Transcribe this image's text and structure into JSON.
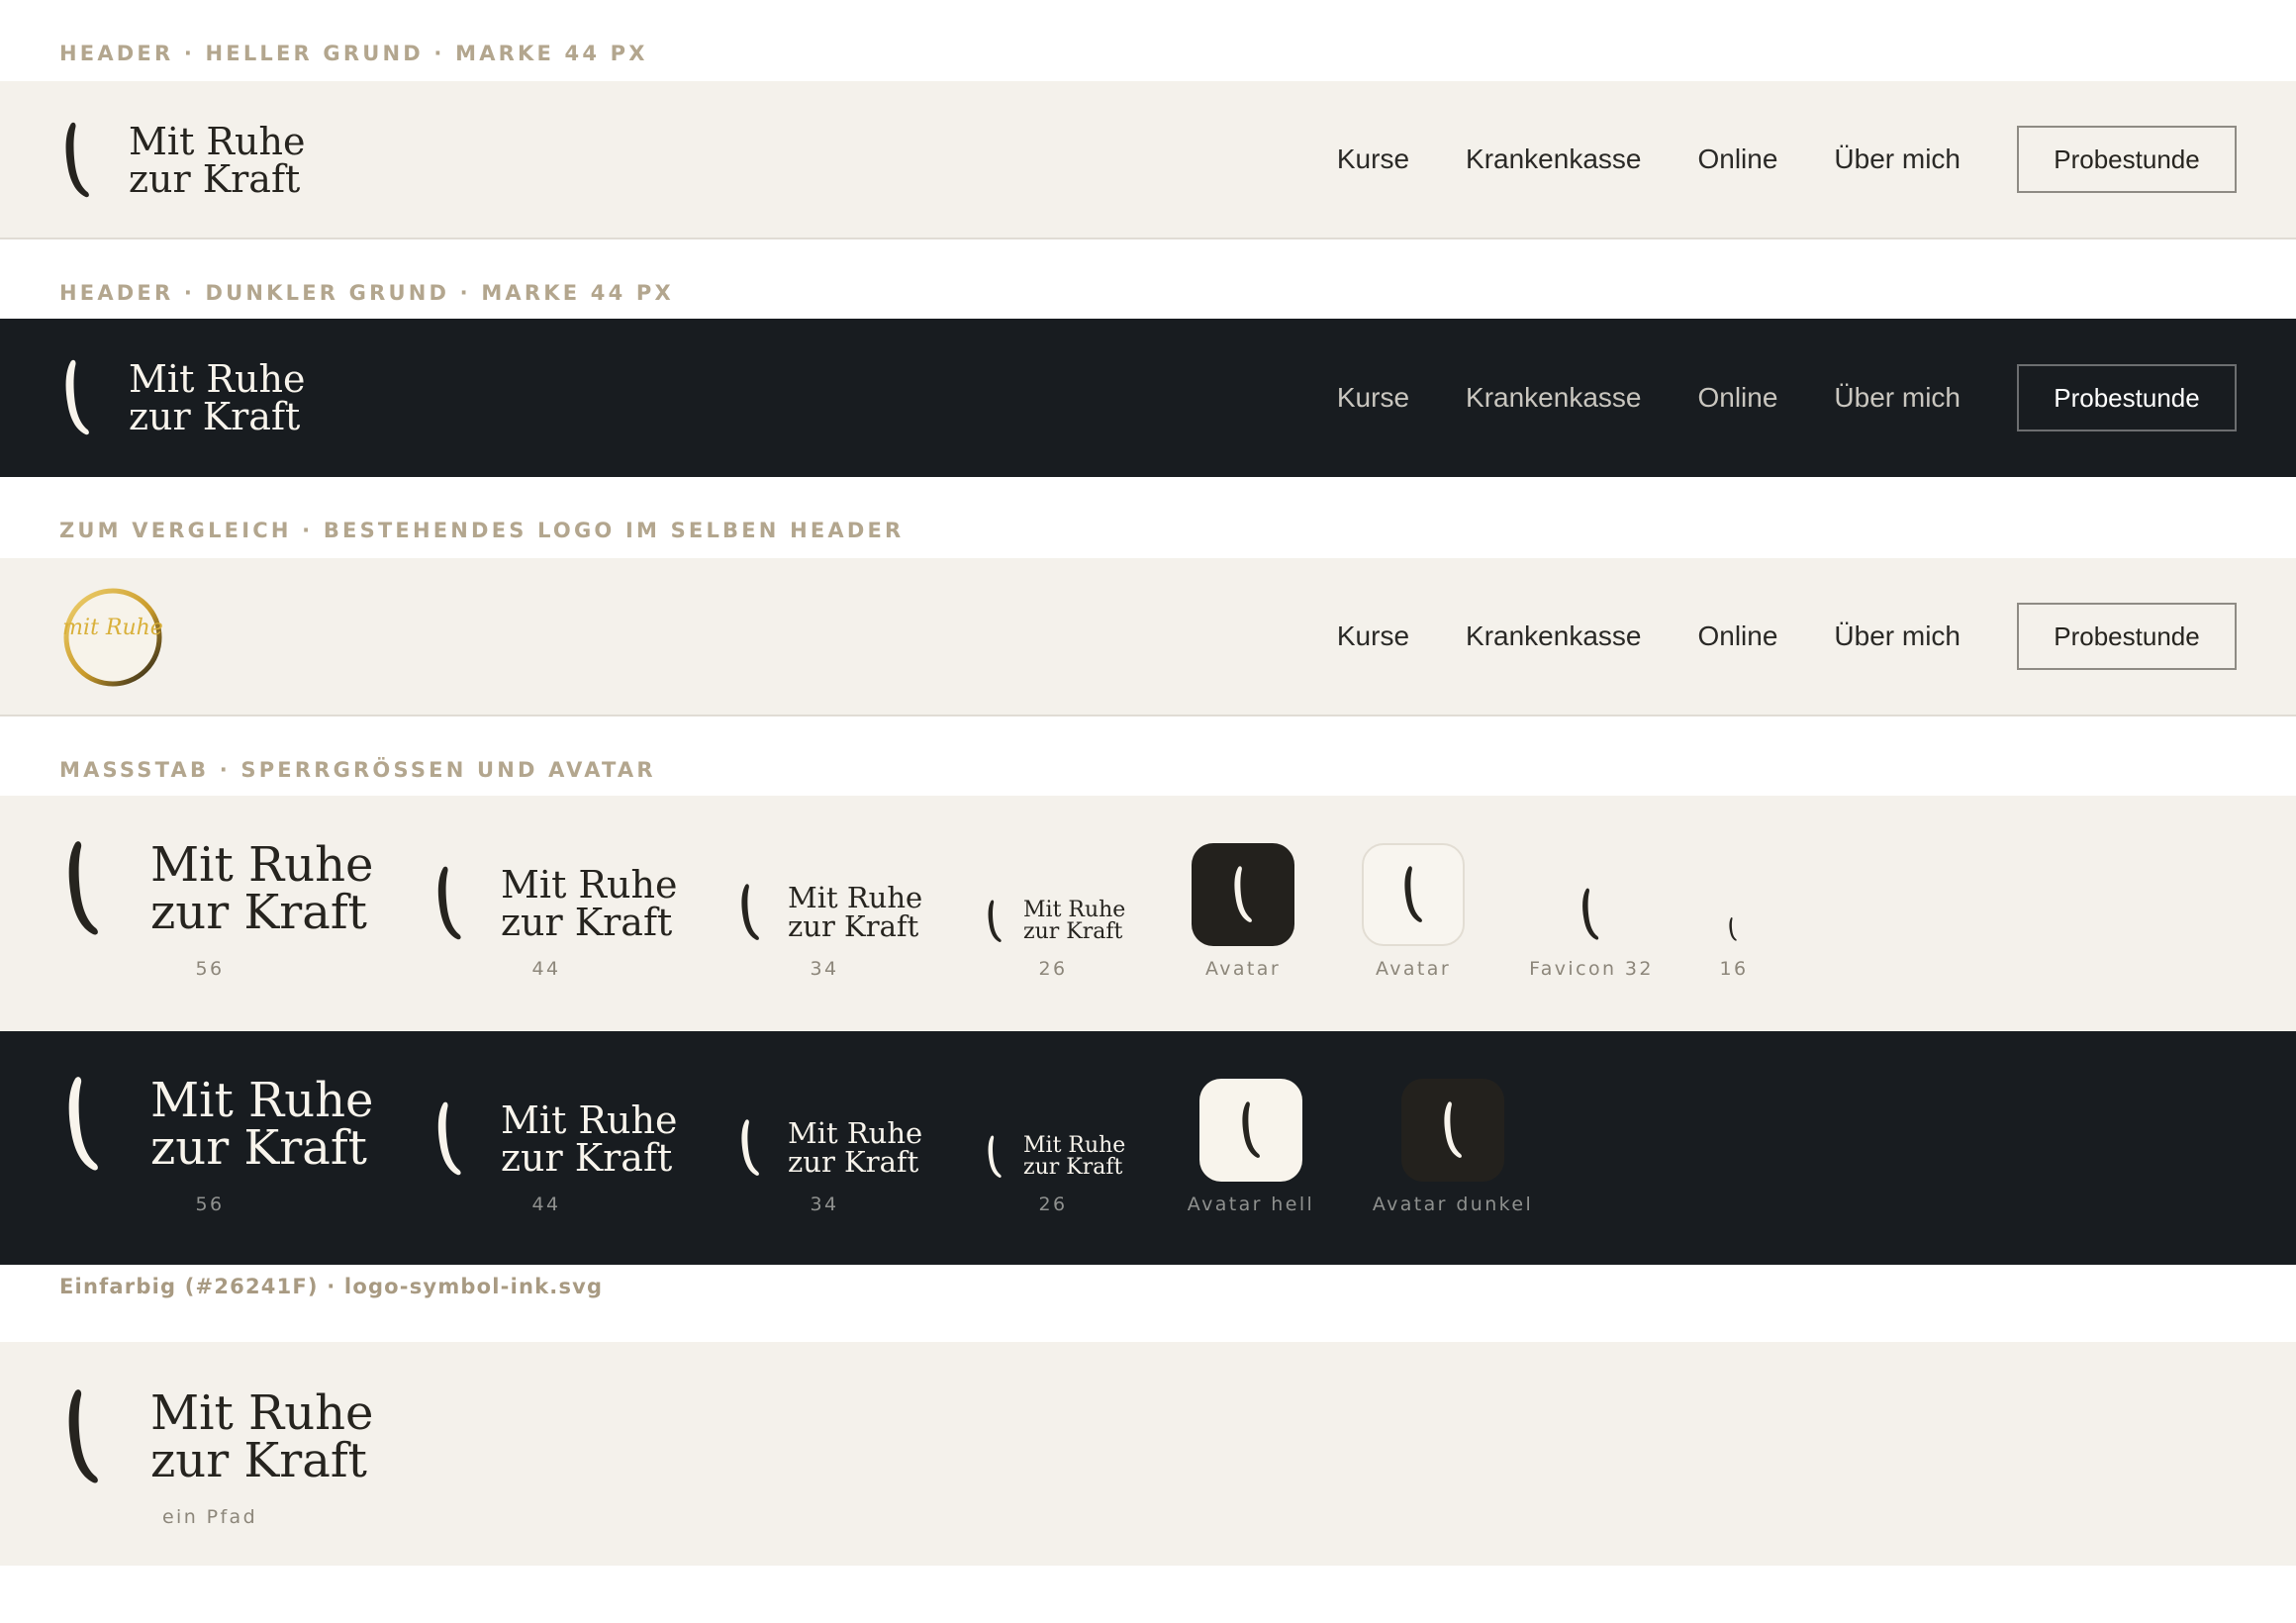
{
  "sections": {
    "header_light": "HEADER · HELLER GRUND · MARKE 44 PX",
    "header_dark": "HEADER · DUNKLER GRUND · MARKE 44 PX",
    "compare": "ZUM VERGLEICH · BESTEHENDES LOGO IM SELBEN HEADER",
    "scale": "MASSSTAB · SPERRGRÖSSEN UND AVATAR",
    "mono": "Einfarbig (#26241F) · logo-symbol-ink.svg"
  },
  "brand": {
    "line1": "Mit Ruhe",
    "line2": "zur Kraft"
  },
  "old_logo": {
    "script": "mit Ruhe"
  },
  "nav": {
    "items": [
      "Kurse",
      "Krankenkasse",
      "Online",
      "Über mich"
    ],
    "cta": "Probestunde"
  },
  "scale_light": {
    "captions": [
      "56",
      "44",
      "34",
      "26",
      "Avatar",
      "Avatar",
      "Favicon 32",
      "16"
    ]
  },
  "scale_dark": {
    "captions": [
      "56",
      "44",
      "34",
      "26",
      "Avatar hell",
      "Avatar dunkel"
    ]
  },
  "mono": {
    "caption": "ein Pfad"
  },
  "colors": {
    "ink": "#26241F",
    "cream": "#F4F1EB",
    "dark": "#181C20",
    "label": "#B3A68E",
    "gold": "#D9B03A"
  },
  "icons": {
    "mark": "brush-stroke-icon"
  }
}
